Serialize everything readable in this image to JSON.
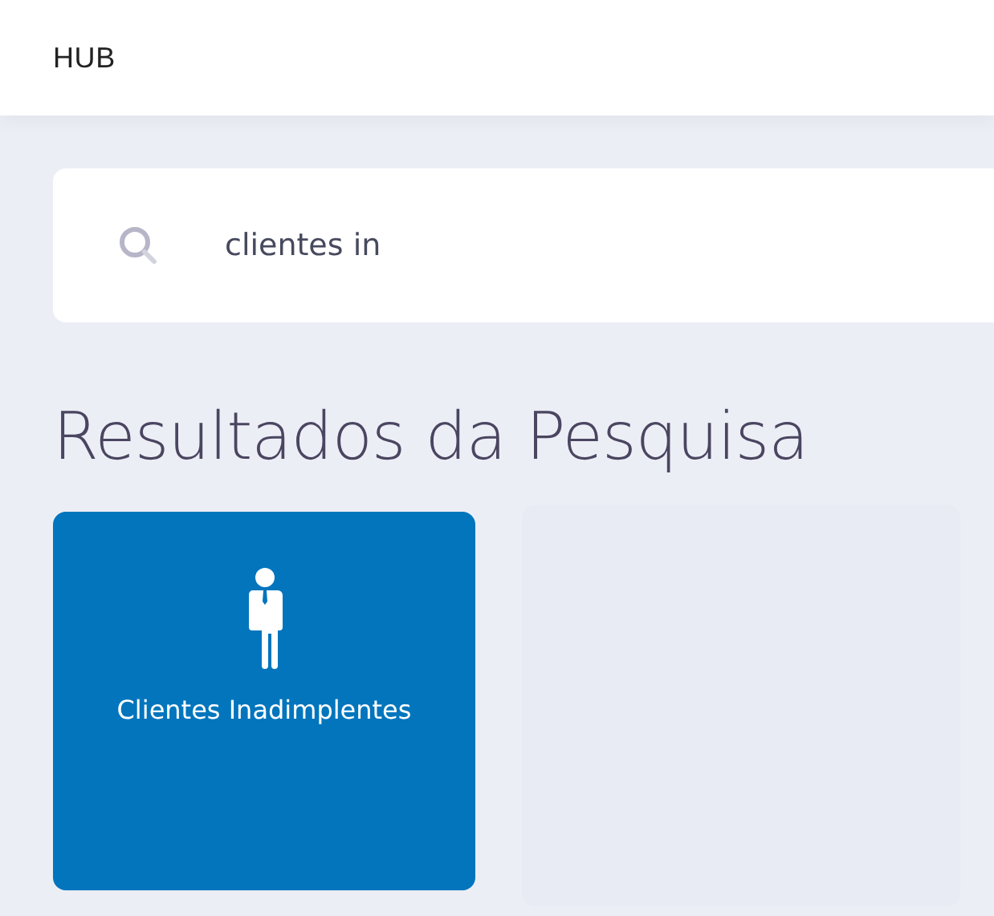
{
  "header": {
    "title": "HUB"
  },
  "search": {
    "value": "clientes in"
  },
  "heading": "Resultados da Pesquisa",
  "results": [
    {
      "label": "Clientes Inadimplentes",
      "kind": "person"
    }
  ]
}
